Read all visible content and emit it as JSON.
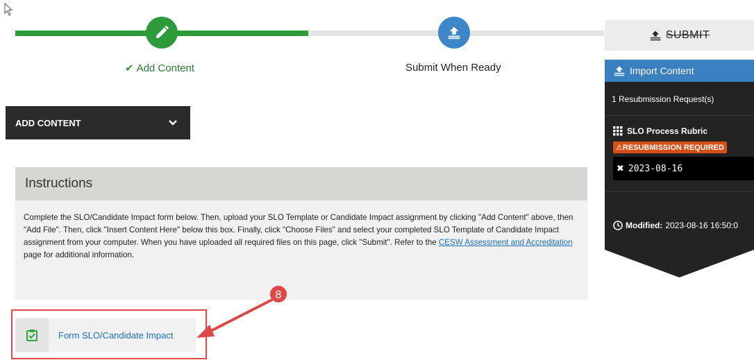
{
  "progress": {
    "steps": [
      {
        "label": "Add Content",
        "state": "complete",
        "icon": "pencil-icon"
      },
      {
        "label": "Submit When Ready",
        "state": "pending",
        "icon": "upload-icon"
      }
    ]
  },
  "toolbar": {
    "submit_label": "SUBMIT",
    "add_content_label": "ADD CONTENT"
  },
  "sidebar": {
    "import_label": "Import Content",
    "resubmission_count": "1 Resubmission Request(s)",
    "rubric_name": "SLO Process Rubric",
    "resubmission_badge": "RESUBMISSION REQUIRED",
    "resubmission_date": "2023-08-16",
    "modified_label": "Modified:",
    "modified_value": "2023-08-16 16:50:0"
  },
  "instructions": {
    "title": "Instructions",
    "text_before_link": "Complete the SLO/Candidate Impact form below.  Then, upload your SLO Template or Candidate Impact assignment by clicking \"Add Content\" above, then \"Add File\".  Then, click \"Insert Content Here\" below this box.  Finally, click \"Choose Files\" and select your completed SLO Template of Candidate Impact assignment from your computer.  When you have uploaded all required files on this page, click \"Submit\".  Refer to the ",
    "link_text": "CESW Assessment and Accreditation",
    "text_after_link": " page for additional information."
  },
  "form_item": {
    "label": "Form SLO/Candidate Impact"
  },
  "annotation": {
    "callout_number": "8",
    "color": "#e04848"
  },
  "colors": {
    "complete": "#2e9b3a",
    "pending": "#3d87c9",
    "import": "#3a7fc0",
    "badge": "#d84f15"
  }
}
